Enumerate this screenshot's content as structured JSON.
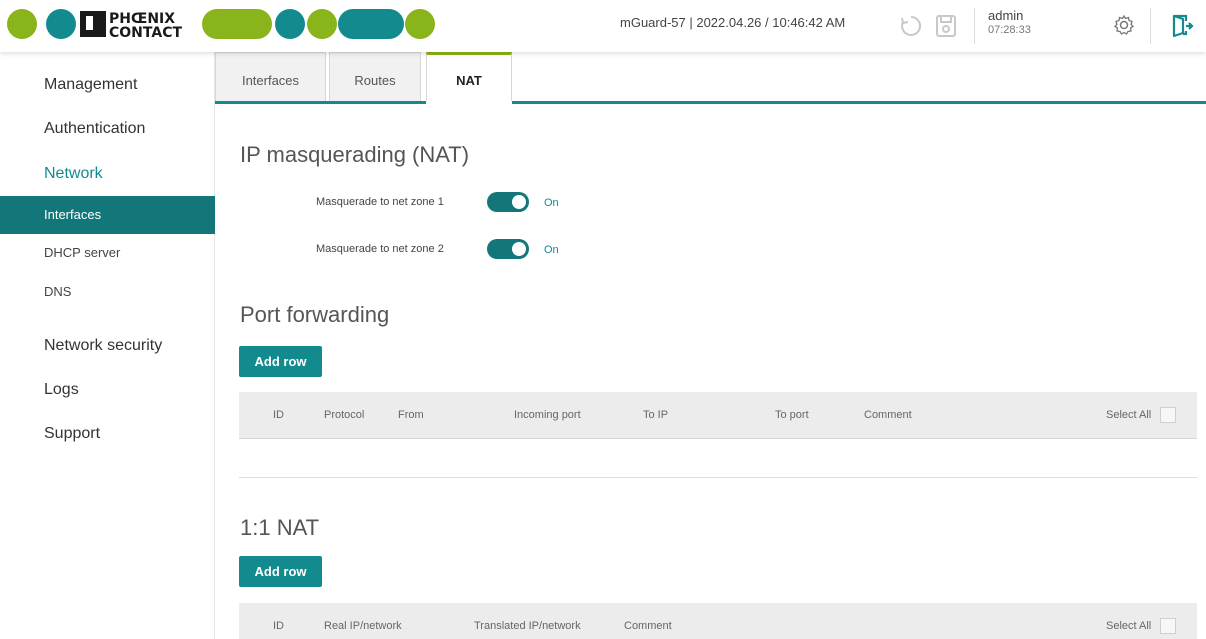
{
  "header": {
    "brand": "PHOENIX CONTACT",
    "device_info": "mGuard-57 | 2022.04.26 / 10:46:42 AM",
    "user": "admin",
    "session_time": "07:28:33",
    "icons": [
      "refresh-icon",
      "save-icon",
      "settings-gear-icon",
      "logout-icon"
    ],
    "colors": {
      "logo_green": "#8ab41c",
      "logo_teal": "#138b8e"
    }
  },
  "sidebar": {
    "items": [
      {
        "label": "Management"
      },
      {
        "label": "Authentication"
      },
      {
        "label": "Network",
        "active": true
      },
      {
        "label": "Interfaces",
        "sub": true,
        "selected": true
      },
      {
        "label": "DHCP server",
        "sub": true
      },
      {
        "label": "DNS",
        "sub": true
      },
      {
        "label": "Network security"
      },
      {
        "label": "Logs"
      },
      {
        "label": "Support"
      }
    ]
  },
  "tabs": [
    {
      "label": "Interfaces"
    },
    {
      "label": "Routes"
    },
    {
      "label": "NAT",
      "active": true
    }
  ],
  "masquerading": {
    "title": "IP masquerading (NAT)",
    "rows": [
      {
        "label": "Masquerade to net zone 1",
        "state": "On"
      },
      {
        "label": "Masquerade to net zone 2",
        "state": "On"
      }
    ]
  },
  "port_forwarding": {
    "title": "Port forwarding",
    "add_label": "Add row",
    "columns": [
      "ID",
      "Protocol",
      "From",
      "Incoming port",
      "To IP",
      "To port",
      "Comment"
    ],
    "select_all": "Select All"
  },
  "one_to_one_nat": {
    "title": "1:1 NAT",
    "add_label": "Add row",
    "columns": [
      "ID",
      "Real IP/network",
      "Translated IP/network",
      "Comment"
    ],
    "select_all": "Select All"
  },
  "accent_color": "#138b8e"
}
